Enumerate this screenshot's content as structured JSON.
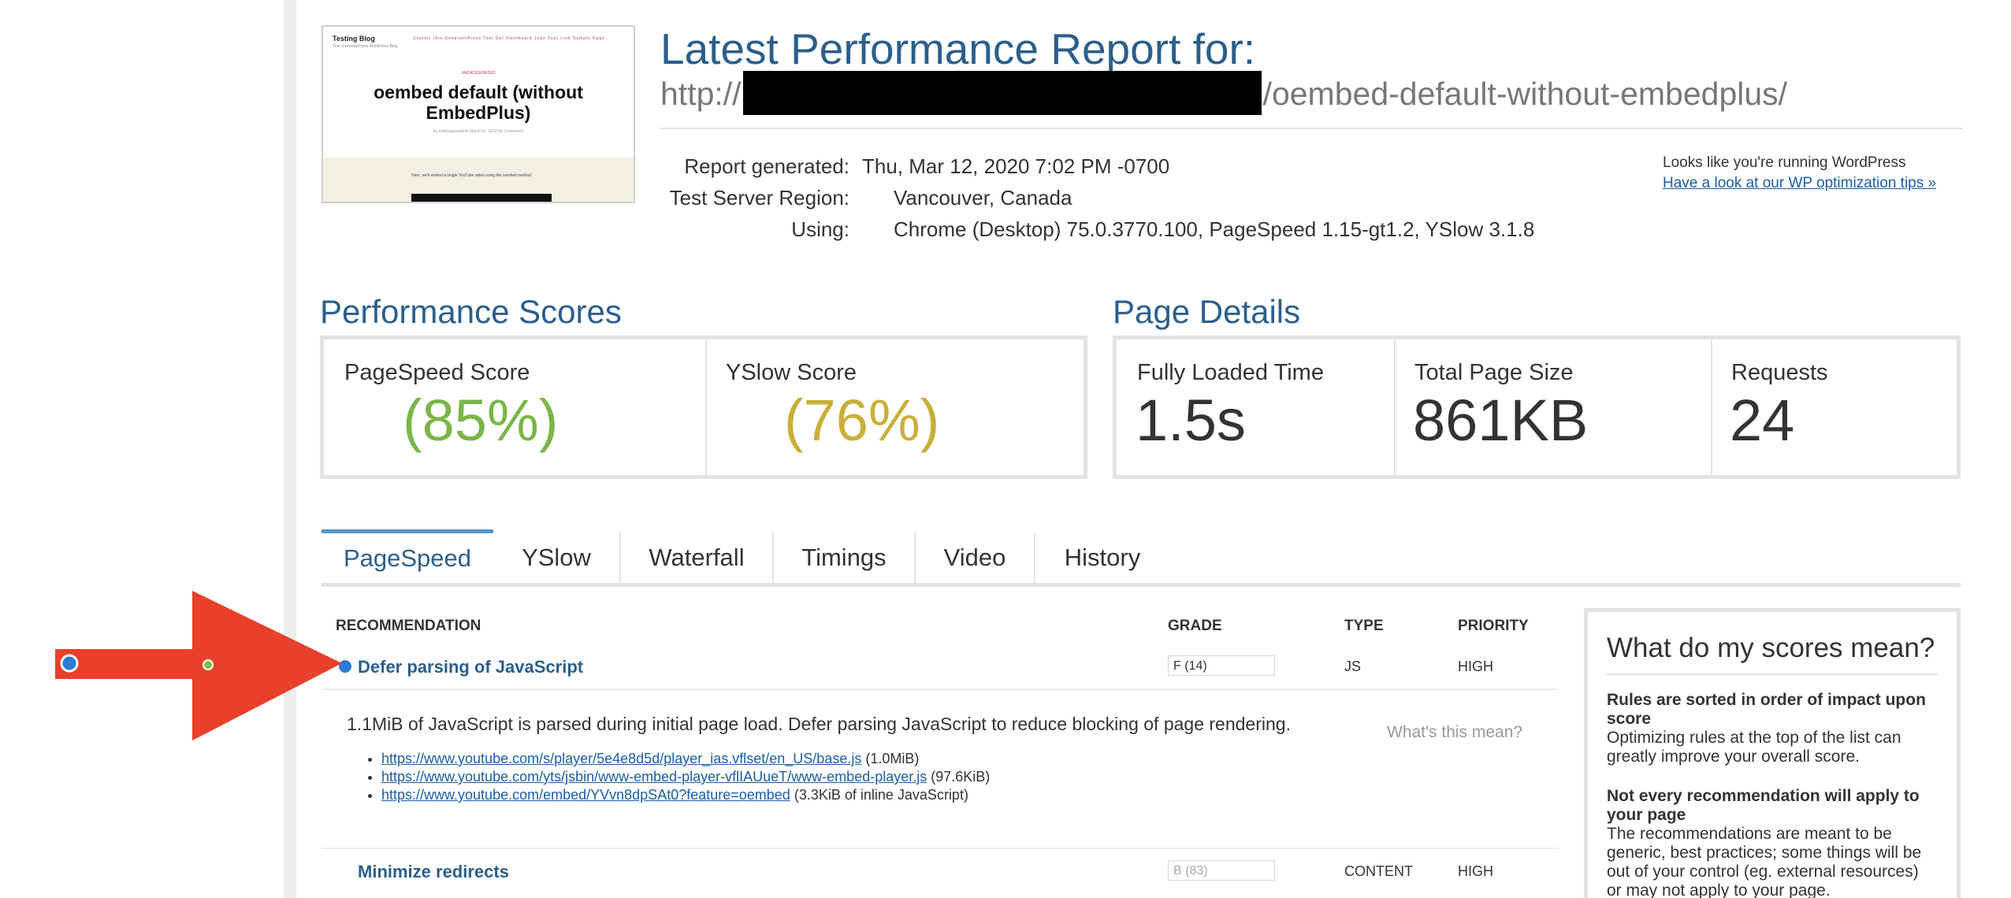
{
  "thumbnail": {
    "brand": "Testing Blog",
    "tagline": "Your GeneratePress WordPress Blog",
    "nav": "Classic Idio   GeneratePress Tool   Get Dashboard   Jobs   Your Link   Sample Page",
    "category": "UNCATEGORIZED",
    "post_title": "oembed default (without EmbedPlus)",
    "post_meta": "by embedplusadmin   March 12, 2020   No Comments",
    "post_body": "Here, we'll embed a single YouTube video using the oembed method"
  },
  "header": {
    "title": "Latest Performance Report for:",
    "url_prefix": "http://",
    "url_suffix": "/oembed-default-without-embedplus/"
  },
  "meta": {
    "generated_label": "Report generated:",
    "generated_value": "Thu, Mar 12, 2020 7:02 PM -0700",
    "region_label": "Test Server Region:",
    "region_value": "Vancouver, Canada",
    "using_label": "Using:",
    "using_value": "Chrome (Desktop) 75.0.3770.100, PageSpeed 1.15-gt1.2, YSlow 3.1.8"
  },
  "wordpress": {
    "note": "Looks like you're running WordPress",
    "link": "Have a look at our WP optimization tips »"
  },
  "scores": {
    "section_title": "Performance Scores",
    "pagespeed_label": "PageSpeed Score",
    "pagespeed_value": "(85%)",
    "yslow_label": "YSlow Score",
    "yslow_value": "(76%)",
    "colors": {
      "pagespeed": "#7ab648",
      "yslow": "#c9b037"
    }
  },
  "details": {
    "section_title": "Page Details",
    "loaded_label": "Fully Loaded Time",
    "loaded_value": "1.5s",
    "size_label": "Total Page Size",
    "size_value": "861KB",
    "requests_label": "Requests",
    "requests_value": "24"
  },
  "tabs": [
    "PageSpeed",
    "YSlow",
    "Waterfall",
    "Timings",
    "Video",
    "History"
  ],
  "active_tab": "PageSpeed",
  "table": {
    "headers": {
      "recommendation": "RECOMMENDATION",
      "grade": "GRADE",
      "type": "TYPE",
      "priority": "PRIORITY"
    },
    "rows": [
      {
        "title": "Defer parsing of JavaScript",
        "grade": "F (14)",
        "type": "JS",
        "priority": "HIGH",
        "description": "1.1MiB of JavaScript is parsed during initial page load. Defer parsing JavaScript to reduce blocking of page rendering.",
        "whats_this": "What's this mean?",
        "resources": [
          {
            "url": "https://www.youtube.com/s/player/5e4e8d5d/player_ias.vflset/en_US/base.js",
            "note": "(1.0MiB)"
          },
          {
            "url": "https://www.youtube.com/yts/jsbin/www-embed-player-vflIAUueT/www-embed-player.js",
            "note": "(97.6KiB)"
          },
          {
            "url": "https://www.youtube.com/embed/YVvn8dpSAt0?feature=oembed",
            "note": "(3.3KiB of inline JavaScript)"
          }
        ]
      },
      {
        "title": "Minimize redirects",
        "grade": "B (83)",
        "type": "CONTENT",
        "priority": "HIGH"
      }
    ]
  },
  "side_panel": {
    "title": "What do my scores mean?",
    "block1_title": "Rules are sorted in order of impact upon score",
    "block1_text": "Optimizing rules at the top of the list can greatly improve your overall score.",
    "block2_title": "Not every recommendation will apply to your page",
    "block2_text": "The recommendations are meant to be generic, best practices; some things will be out of your control (eg. external resources) or may not apply to your page."
  },
  "annotation": {
    "arrow_color": "#e8402a"
  }
}
